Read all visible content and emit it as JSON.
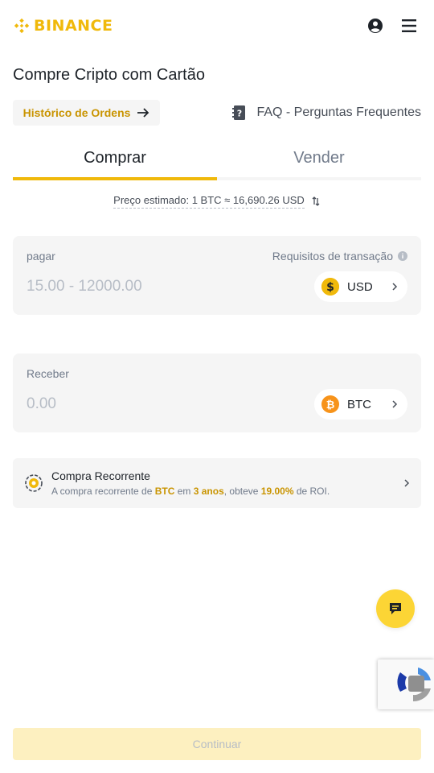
{
  "brand": {
    "name": "BINANCE",
    "color": "#f0b90b"
  },
  "header": {
    "profile_icon": "user-circle-icon",
    "menu_icon": "hamburger-menu-icon"
  },
  "page_title": "Compre Cripto com Cartão",
  "order_history": {
    "label": "Histórico de Ordens",
    "icon": "arrow-right-icon"
  },
  "faq": {
    "label": "FAQ - Perguntas Frequentes",
    "icon": "question-book-icon"
  },
  "tabs": [
    {
      "label": "Comprar",
      "active": true
    },
    {
      "label": "Vender",
      "active": false
    }
  ],
  "estimated_price": {
    "text": "Preço estimado: 1 BTC ≈ 16,690.26 USD",
    "icon": "swap-vertical-icon"
  },
  "pay": {
    "label": "pagar",
    "requirements_label": "Requisitos de transação",
    "placeholder": "15.00 - 12000.00",
    "currency": "USD"
  },
  "receive": {
    "label": "Receber",
    "placeholder": "0.00",
    "currency": "BTC"
  },
  "recurring": {
    "title": "Compra Recorrente",
    "sub_prefix": "A compra recorrente de ",
    "coin": "BTC",
    "sub_mid1": " em ",
    "period": "3 anos",
    "sub_mid2": ", obteve ",
    "roi": "19.00%",
    "sub_suffix": " de ROI."
  },
  "continue_label": "Continuar",
  "colors": {
    "accent": "#f0b90b",
    "accent_text": "#c99400",
    "card_bg": "#f5f5f5",
    "disabled_button": "#fdf0c0"
  }
}
